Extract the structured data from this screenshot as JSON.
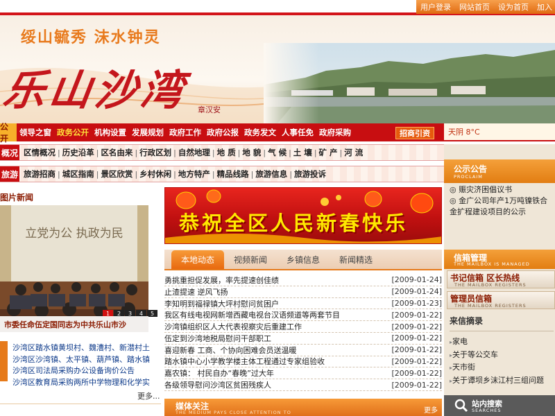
{
  "toplinks": [
    "用户登录",
    "网站首页",
    "设为首页",
    "加入"
  ],
  "banner": {
    "slogan": "绥山毓秀  沫水钟灵",
    "calligraphy": "乐山沙湾",
    "seal": "章汉安"
  },
  "nav1": {
    "label": "公开",
    "items": [
      {
        "label": "领导之窗",
        "active": false
      },
      {
        "label": "政务公开",
        "active": true
      },
      {
        "label": "机构设置",
        "active": false
      },
      {
        "label": "发展规划",
        "active": false
      },
      {
        "label": "政府工作",
        "active": false
      },
      {
        "label": "政府公报",
        "active": false
      },
      {
        "label": "政务发文",
        "active": false
      },
      {
        "label": "人事任免",
        "active": false
      },
      {
        "label": "政府采购",
        "active": false
      }
    ],
    "invest_button": "招商引资"
  },
  "weather": "天阴 8°C",
  "nav2": {
    "label": "概况",
    "items": [
      "区情概况",
      "历史沿革",
      "区名由来",
      "行政区划",
      "自然地理",
      "地  质",
      "地  貌",
      "气  候",
      "土  壤",
      "矿  产",
      "河  流"
    ]
  },
  "nav3": {
    "label": "旅游",
    "items": [
      "旅游招商",
      "城区指南",
      "景区欣赏",
      "乡村休闲",
      "地方特产",
      "精品线路",
      "旅游信息",
      "旅游投诉"
    ]
  },
  "photo_news": {
    "title": "图片新闻",
    "wall_text": "立党为公  执政为民",
    "caption": "市委任命伍定国同志为中共乐山市沙",
    "pages": [
      "1",
      "2",
      "3",
      "4",
      "5"
    ],
    "active_page": 0
  },
  "left_list": {
    "items": [
      "沙湾区踏水镇黄坝村、魏漕村、新潜村土",
      "沙湾区沙湾镇、太平镇、葫芦镇、踏水镇",
      "沙湾区司法局采购办公设备询价公告",
      "沙湾区教育局采购两所中学物理和化学实"
    ],
    "more": "更多..."
  },
  "spring_banner": "恭祝全区人民新春快乐",
  "tabs": [
    {
      "label": "本地动态",
      "active": true
    },
    {
      "label": "视频新闻",
      "active": false
    },
    {
      "label": "乡镇信息",
      "active": false
    },
    {
      "label": "新闻精选",
      "active": false
    }
  ],
  "news": [
    {
      "title": "勇挑重担促发展，率先提速创佳绩",
      "date": "[2009-01-24]"
    },
    {
      "title": "止渣提速  逆风飞扬",
      "date": "[2009-01-24]"
    },
    {
      "title": "李知明到福禄镇大坪村慰问贫困户",
      "date": "[2009-01-23]"
    },
    {
      "title": "我区有线电视网新增西藏电视台汉语频道等两套节目",
      "date": "[2009-01-22]"
    },
    {
      "title": "沙湾镇组织区人大代表视察灾后重建工作",
      "date": "[2009-01-22]"
    },
    {
      "title": "伍定到沙湾地税局慰问干部职工",
      "date": "[2009-01-22]"
    },
    {
      "title": "喜迎新春  工商、个协向困难会员送温暖",
      "date": "[2009-01-22]"
    },
    {
      "title": "踏水镇中心小学教学楼主体工程通过专家组验收",
      "date": "[2009-01-22]"
    },
    {
      "title": "嘉农镇：  村民自办“春晚”过大年",
      "date": "[2009-01-22]"
    },
    {
      "title": "各级领导慰问沙湾区贫困残疾人",
      "date": "[2009-01-22]"
    }
  ],
  "media": {
    "title": "媒体关注",
    "subtitle": "THE MEDIUM PAYS CLOSE ATTENTION TO",
    "more": "更多"
  },
  "notice": {
    "title": "公示公告",
    "subtitle": "PROCLAIM",
    "items": [
      "◎ 赈灾济困倡议书",
      "◎ 金广公司年产1万吨镍铁合金扩程建设项目的公示"
    ]
  },
  "mailbox": {
    "title": "信箱管理",
    "subtitle": "THE MAILBOX IS MANAGED",
    "btn1": "书记信箱  区长热线",
    "btn2": "管理员信箱",
    "btn_sub": "THE MAILBOX REGISTERS"
  },
  "letters": {
    "title": "来信摘录",
    "items": [
      "家电",
      "关于等公交车",
      "天市街",
      "关于谭坝乡沫江村三组问题"
    ]
  },
  "site_search": {
    "title": "站内搜索",
    "subtitle": "SEARCHES"
  }
}
